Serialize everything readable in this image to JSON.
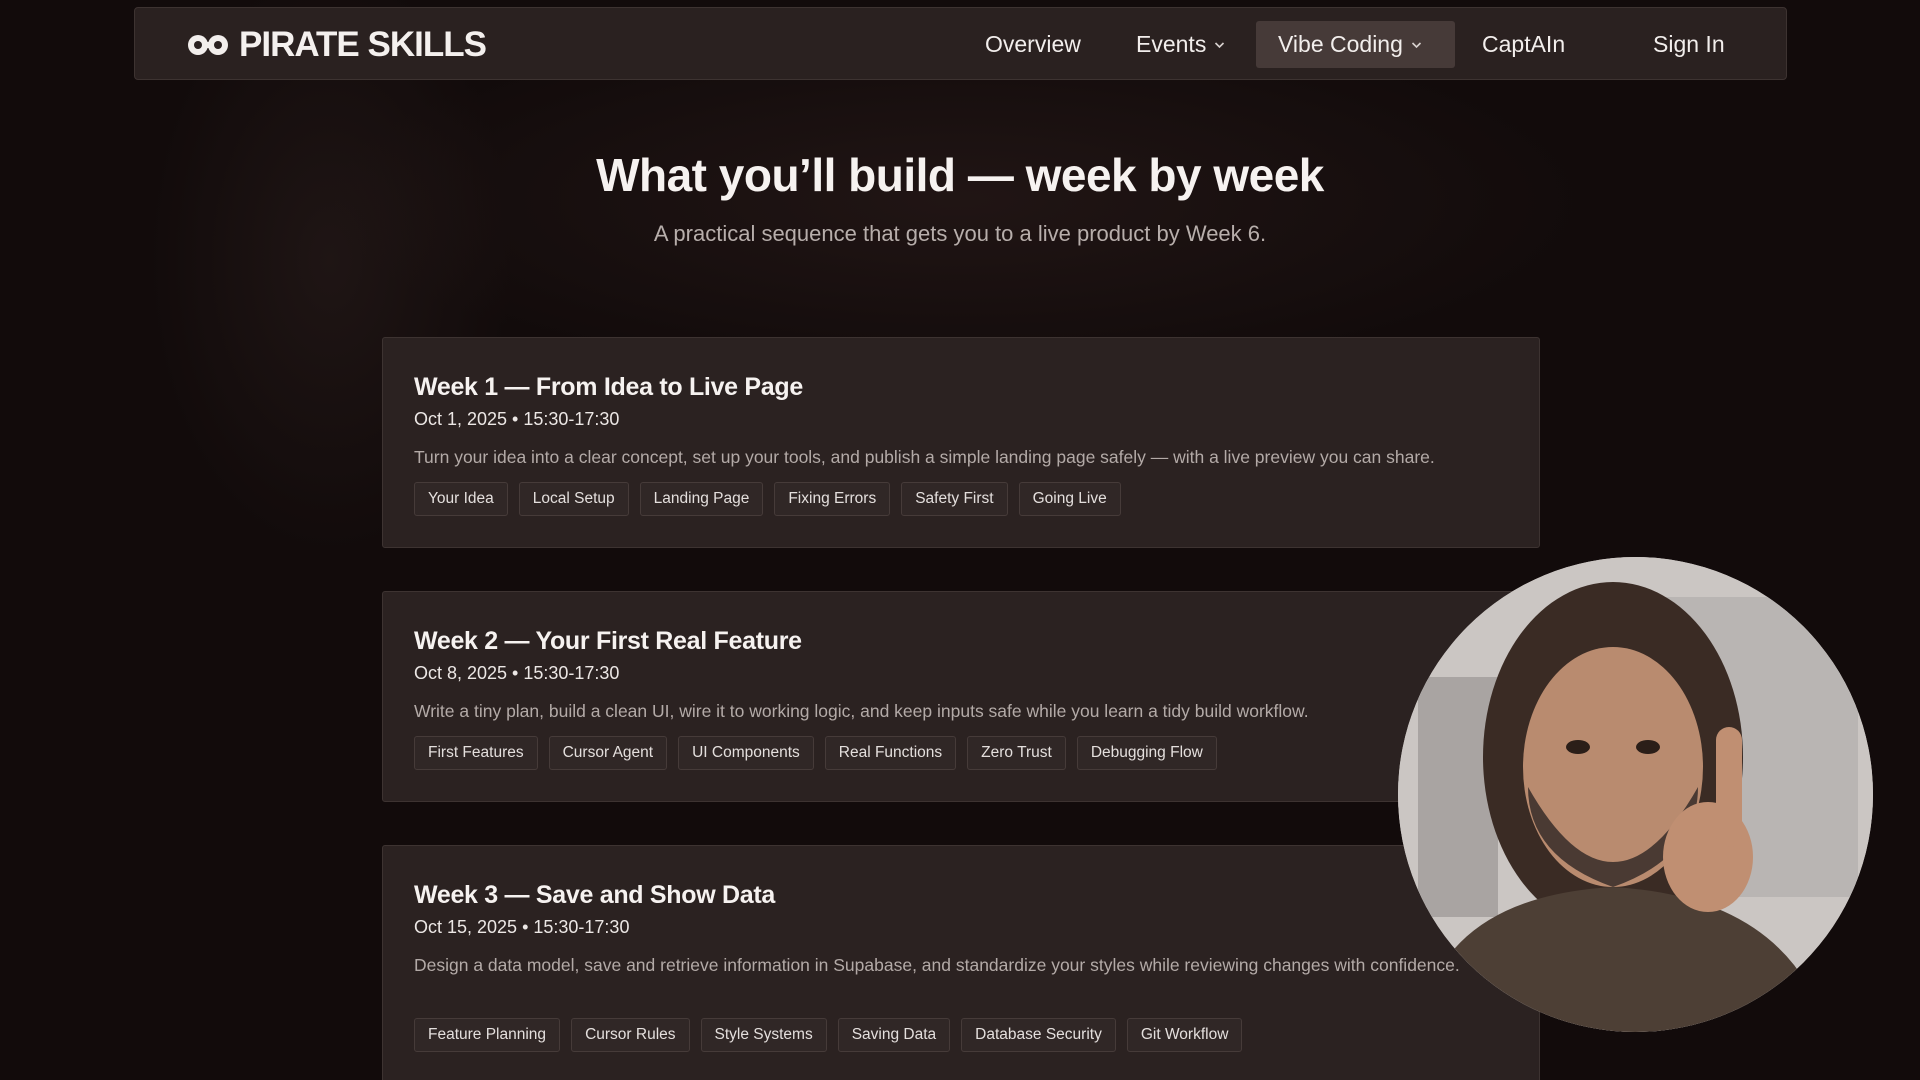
{
  "header": {
    "brand_name": "PIRATE SKILLS",
    "brand_icon": "infinity-logo-icon",
    "nav": [
      {
        "label": "Overview",
        "has_dropdown": false
      },
      {
        "label": "Events",
        "has_dropdown": true
      },
      {
        "label": "Vibe Coding",
        "has_dropdown": true,
        "active": true
      },
      {
        "label": "CaptAIn",
        "has_dropdown": false
      }
    ],
    "sign_in_label": "Sign In"
  },
  "hero": {
    "title": "What you’ll build — week by week",
    "subtitle": "A practical sequence that gets you to a live product by Week 6."
  },
  "weeks": [
    {
      "title": "Week 1 — From Idea to Live Page",
      "date": "Oct 1, 2025 • 15:30-17:30",
      "description": "Turn your idea into a clear concept, set up your tools, and publish a simple landing page safely — with a live preview you can share.",
      "tags": [
        "Your Idea",
        "Local Setup",
        "Landing Page",
        "Fixing Errors",
        "Safety First",
        "Going Live"
      ]
    },
    {
      "title": "Week 2 — Your First Real Feature",
      "date": "Oct 8, 2025 • 15:30-17:30",
      "description": "Write a tiny plan, build a clean UI, wire it to working logic, and keep inputs safe while you learn a tidy build workflow.",
      "tags": [
        "First Features",
        "Cursor Agent",
        "UI Components",
        "Real Functions",
        "Zero Trust",
        "Debugging Flow"
      ]
    },
    {
      "title": "Week 3 — Save and Show Data",
      "date": "Oct 15, 2025 • 15:30-17:30",
      "description": "Design a data model, save and retrieve information in Supabase, and standardize your styles while reviewing changes with confidence.",
      "tags": [
        "Feature Planning",
        "Cursor Rules",
        "Style Systems",
        "Saving Data",
        "Database Security",
        "Git Workflow"
      ]
    }
  ],
  "colors": {
    "page_bg": "#120b0b",
    "card_bg": "#2b2221",
    "nav_active_bg": "#463a38",
    "text_primary": "#f6f2f0",
    "text_muted": "#b3aaa7"
  }
}
